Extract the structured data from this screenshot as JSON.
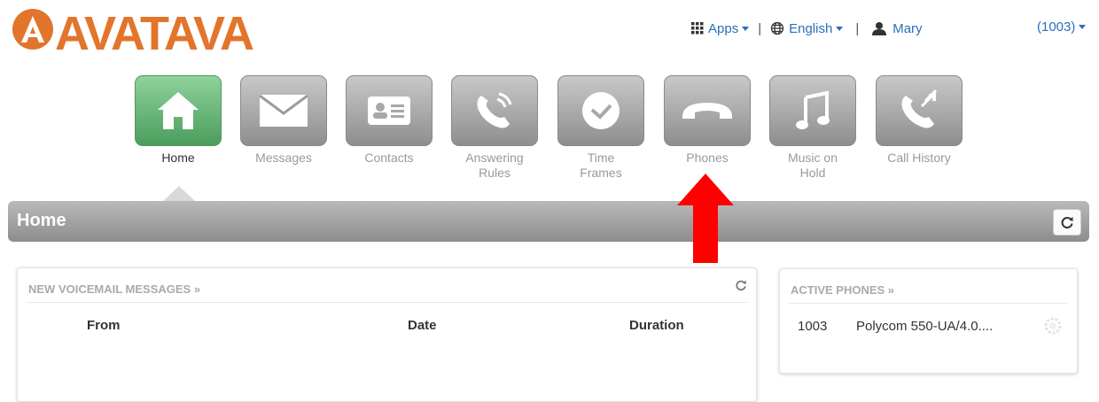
{
  "brand": {
    "logo_text": "AVATAVA",
    "logo_color": "#e2752b"
  },
  "topnav": {
    "apps_label": "Apps",
    "language_label": "English",
    "user_label": "Mary",
    "separator": "|",
    "extension_label": "(1003)"
  },
  "tiles": [
    {
      "label": "Home",
      "icon": "home-icon",
      "active": true
    },
    {
      "label": "Messages",
      "icon": "envelope-icon"
    },
    {
      "label": "Contacts",
      "icon": "contact-card-icon"
    },
    {
      "label": "Answering\nRules",
      "icon": "phone-ringing-icon"
    },
    {
      "label": "Time\nFrames",
      "icon": "clock-icon"
    },
    {
      "label": "Phones",
      "icon": "handset-icon"
    },
    {
      "label": "Music on\nHold",
      "icon": "music-note-icon"
    },
    {
      "label": "Call History",
      "icon": "call-history-icon"
    }
  ],
  "header": {
    "title": "Home"
  },
  "voicemail": {
    "title": "NEW VOICEMAIL MESSAGES »",
    "columns": [
      "From",
      "Date",
      "Duration"
    ]
  },
  "active_phones": {
    "title": "ACTIVE PHONES »",
    "rows": [
      {
        "extension": "1003",
        "device": "Polycom 550-UA/4.0...."
      }
    ]
  },
  "colors": {
    "link": "#2a6ebb",
    "active_tile": "#5fae70",
    "annotation_arrow": "#ff0000"
  }
}
